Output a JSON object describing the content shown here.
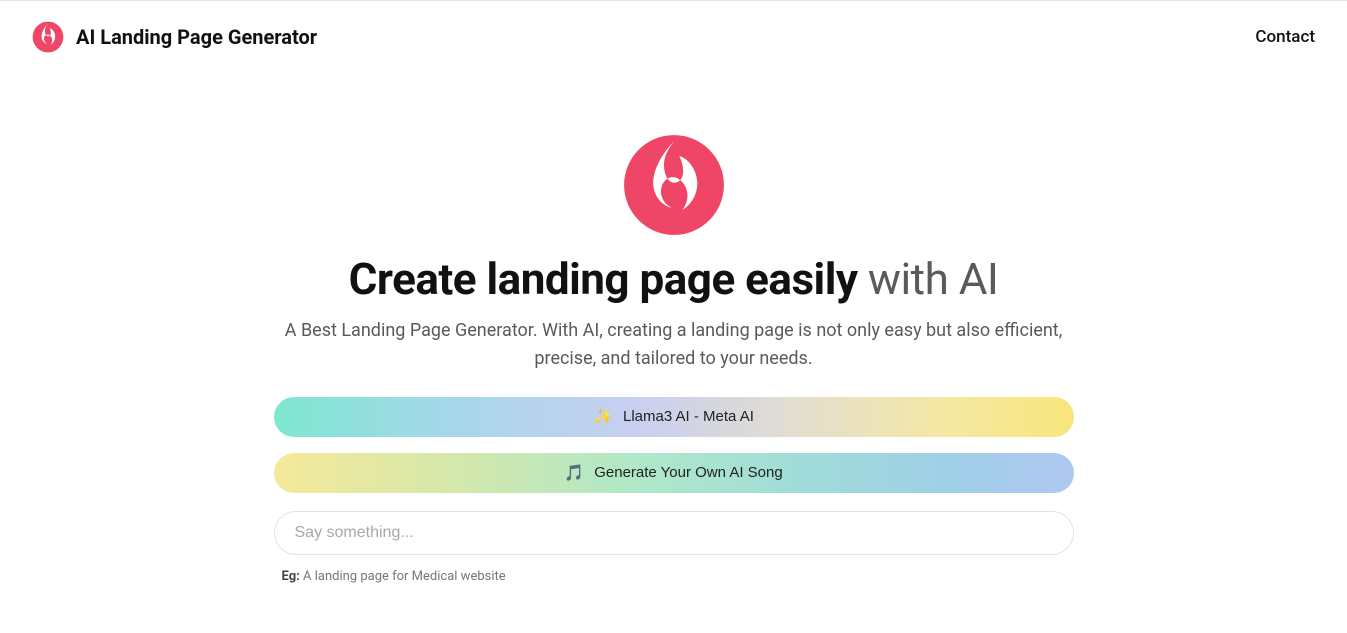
{
  "header": {
    "brand_title": "AI Landing Page Generator",
    "contact_label": "Contact"
  },
  "hero": {
    "headline_strong": "Create landing page easily",
    "headline_light": " with AI",
    "subtitle": "A Best Landing Page Generator. With AI, creating a landing page is not only easy but also efficient, precise, and tailored to your needs."
  },
  "pills": [
    {
      "emoji": "✨",
      "label": "Llama3 AI - Meta AI"
    },
    {
      "emoji": "🎵",
      "label": "Generate Your Own AI Song"
    }
  ],
  "input": {
    "placeholder": "Say something..."
  },
  "example": {
    "prefix": "Eg: ",
    "text": "A landing page for Medical website"
  }
}
